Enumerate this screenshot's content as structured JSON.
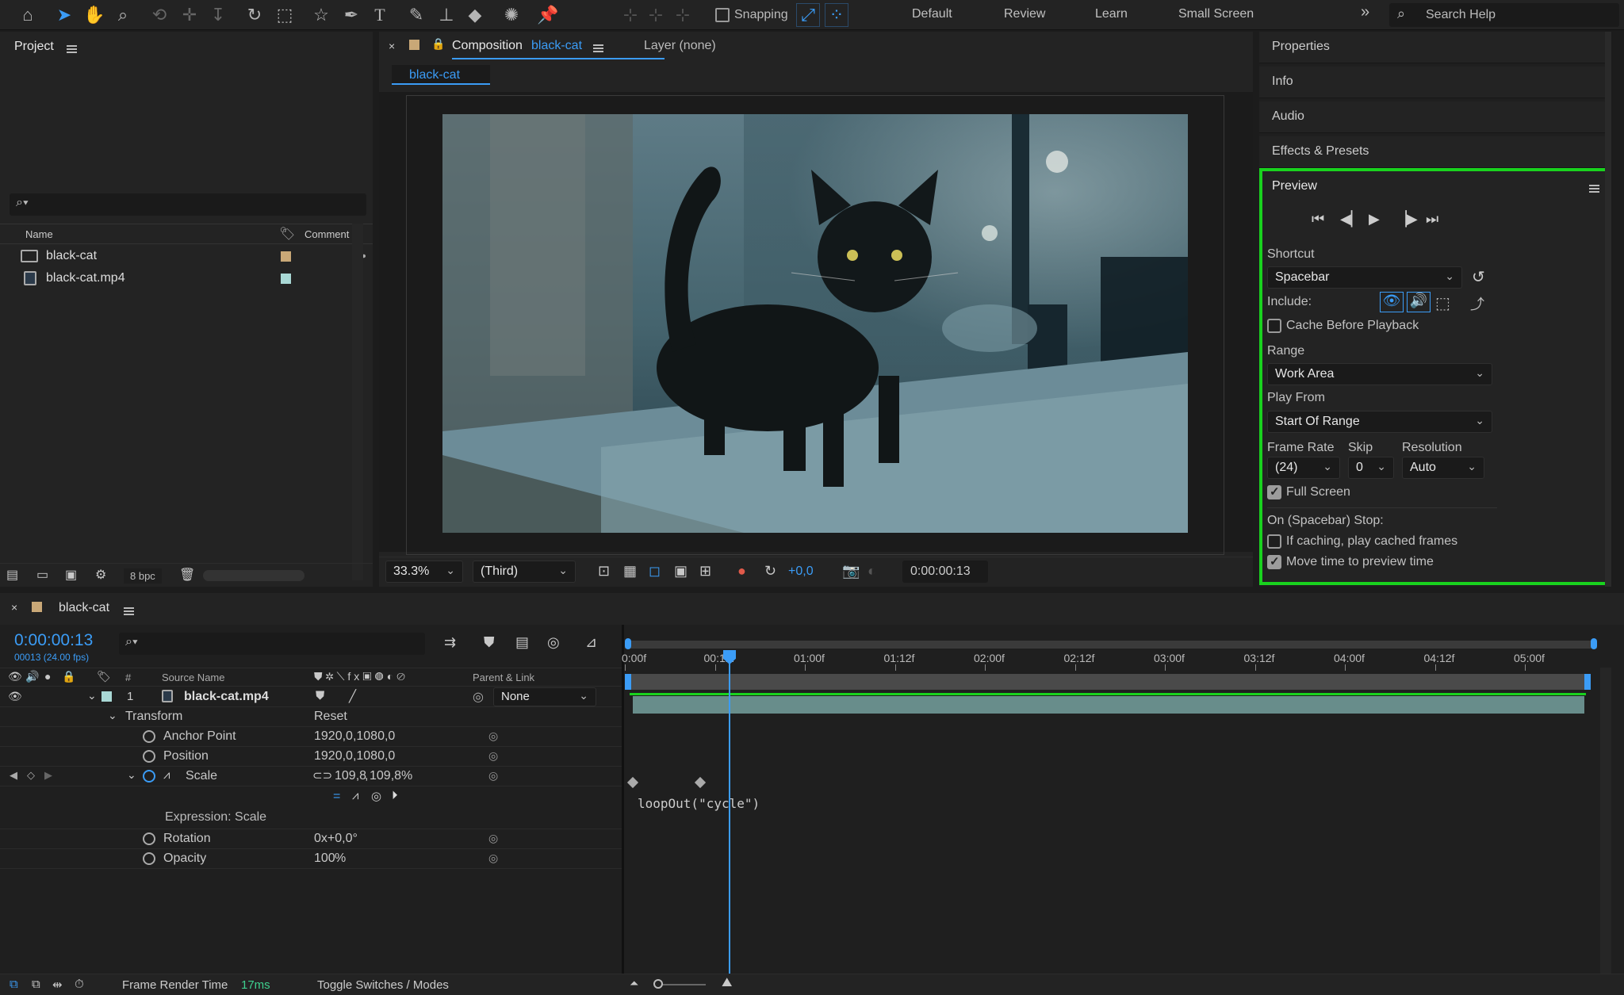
{
  "toolbar": {
    "snapping_label": "Snapping",
    "workspaces": [
      "Default",
      "Review",
      "Learn",
      "Small Screen"
    ],
    "search_placeholder": "Search Help"
  },
  "project": {
    "title": "Project",
    "col_name": "Name",
    "col_comment": "Comment",
    "items": [
      {
        "name": "black-cat",
        "swatch": "#c9a877"
      },
      {
        "name": "black-cat.mp4",
        "swatch": "#a9d8d5"
      }
    ],
    "bpc": "8 bpc"
  },
  "comp": {
    "tab_label": "Composition",
    "tab_name": "black-cat",
    "layer_tab": "Layer (none)",
    "breadcrumb": "black-cat",
    "zoom": "33.3%",
    "resolution": "(Third)",
    "exposure": "+0,0",
    "timecode": "0:00:00:13"
  },
  "right": {
    "properties": "Properties",
    "info": "Info",
    "audio": "Audio",
    "effects": "Effects & Presets"
  },
  "preview": {
    "title": "Preview",
    "shortcut_label": "Shortcut",
    "shortcut_value": "Spacebar",
    "include_label": "Include:",
    "cache_label": "Cache Before Playback",
    "range_label": "Range",
    "range_value": "Work Area",
    "play_from_label": "Play From",
    "play_from_value": "Start Of Range",
    "frame_rate_label": "Frame Rate",
    "skip_label": "Skip",
    "resolution_label": "Resolution",
    "frame_rate_value": "(24)",
    "skip_value": "0",
    "resolution_value": "Auto",
    "full_screen_label": "Full Screen",
    "stop_label": "On (Spacebar) Stop:",
    "if_caching_label": "If caching, play cached frames",
    "move_time_label": "Move time to preview time",
    "highlight_color": "#19d21e"
  },
  "timeline": {
    "comp_name": "black-cat",
    "current_time": "0:00:00:13",
    "frame_info": "00013 (24.00 fps)",
    "col_hash": "#",
    "col_source": "Source Name",
    "col_parent": "Parent & Link",
    "layer_index": "1",
    "layer_name": "black-cat.mp4",
    "parent_value": "None",
    "transform_label": "Transform",
    "reset_label": "Reset",
    "properties": [
      {
        "name": "Anchor Point",
        "value": "1920,0,1080,0"
      },
      {
        "name": "Position",
        "value": "1920,0,1080,0"
      },
      {
        "name": "Scale",
        "value_a": "109,8",
        "sep": ",",
        "value_b": "109,8",
        "unit": "%"
      },
      {
        "name": "Rotation",
        "value": "0x+0,0°"
      },
      {
        "name": "Opacity",
        "value": "100",
        "unit": "%"
      }
    ],
    "expression_label": "Expression: Scale",
    "expression_text": "loopOut(\"cycle\")",
    "ruler": [
      "0:00f",
      "00:12f",
      "01:00f",
      "01:12f",
      "02:00f",
      "02:12f",
      "03:00f",
      "03:12f",
      "04:00f",
      "04:12f",
      "05:00f"
    ],
    "footer_render_label": "Frame Render Time",
    "footer_render_value": "17ms",
    "footer_toggle": "Toggle Switches / Modes",
    "accent": "#3b9cf6"
  }
}
